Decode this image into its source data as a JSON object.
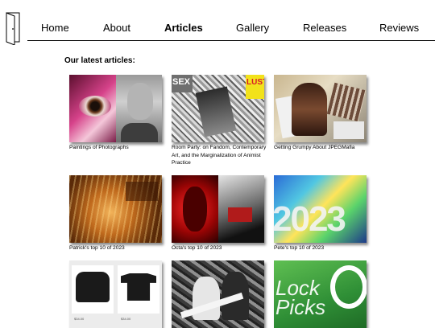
{
  "nav": {
    "items": [
      {
        "label": "Home"
      },
      {
        "label": "About"
      },
      {
        "label": "Articles",
        "active": true
      },
      {
        "label": "Gallery"
      },
      {
        "label": "Releases"
      },
      {
        "label": "Reviews"
      }
    ]
  },
  "main": {
    "heading": "Our latest articles:",
    "articles": [
      {
        "title": "Paintings of Photographs"
      },
      {
        "title": "Room Party: on Fandom, Contemporary Art, and the Marginalization of Animist Practice",
        "image_text": {
          "left": "SEX",
          "right": "LUST"
        }
      },
      {
        "title": "Getting Grumpy About JPEGMafia"
      },
      {
        "title": "Patrick's top 10 of 2023"
      },
      {
        "title": "Octa's top 10 of 2023"
      },
      {
        "title": "Pete's top 10 of 2023",
        "image_text": "2023"
      },
      {
        "title": "",
        "image_text": {
          "price_left": "$34.00",
          "price_right": "$34.00"
        }
      },
      {
        "title": ""
      },
      {
        "title": "",
        "image_text": "Lock Picks"
      }
    ]
  }
}
